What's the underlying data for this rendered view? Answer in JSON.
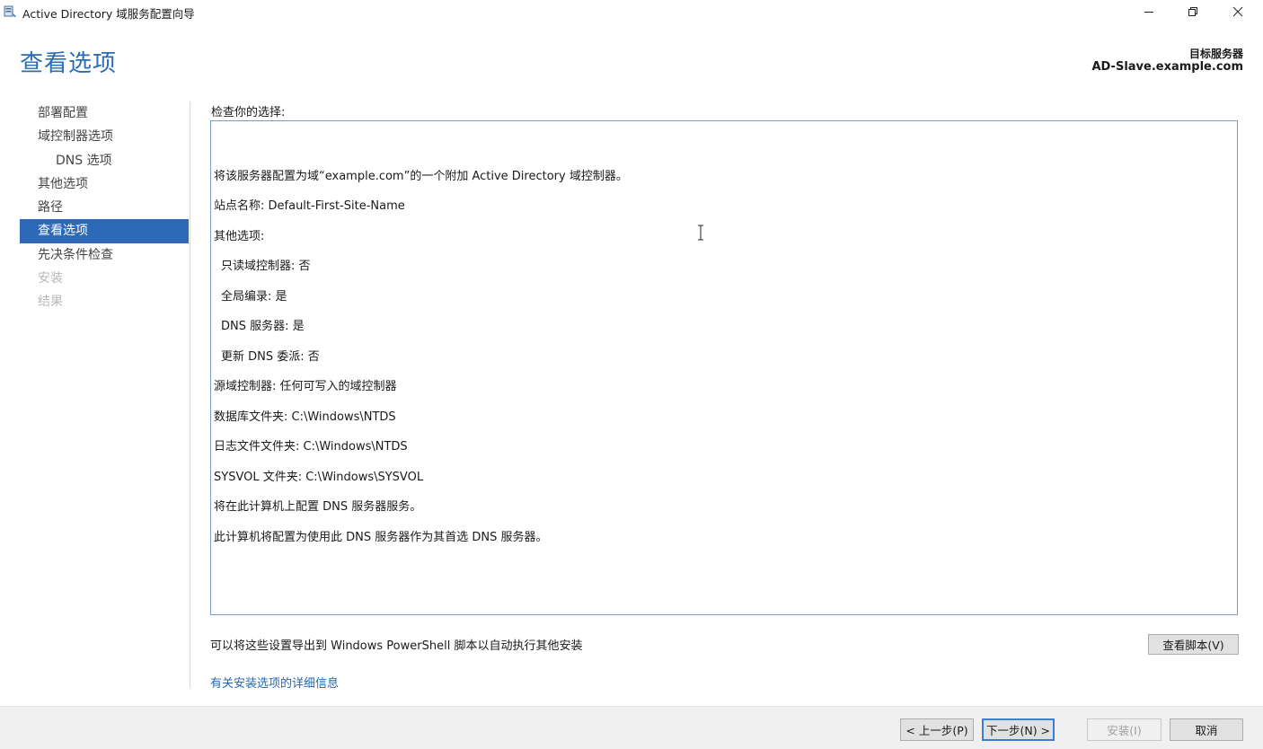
{
  "window": {
    "title": "Active Directory 域服务配置向导",
    "icon": "server-wizard-icon"
  },
  "header": {
    "page_title": "查看选项",
    "target_server_label": "目标服务器",
    "target_server_value": "AD-Slave.example.com"
  },
  "sidebar": {
    "items": [
      {
        "label": "部署配置",
        "state": "normal"
      },
      {
        "label": "域控制器选项",
        "state": "normal"
      },
      {
        "label": "DNS 选项",
        "state": "sub"
      },
      {
        "label": "其他选项",
        "state": "normal"
      },
      {
        "label": "路径",
        "state": "normal"
      },
      {
        "label": "查看选项",
        "state": "active"
      },
      {
        "label": "先决条件检查",
        "state": "normal"
      },
      {
        "label": "安装",
        "state": "disabled"
      },
      {
        "label": "结果",
        "state": "disabled"
      }
    ]
  },
  "main": {
    "review_label": "检查你的选择:",
    "summary_lines": [
      "将该服务器配置为域“example.com”的一个附加 Active Directory 域控制器。",
      "站点名称: Default-First-Site-Name",
      "其他选项:",
      "只读域控制器: 否",
      "全局编录: 是",
      "DNS 服务器: 是",
      "更新 DNS 委派: 否",
      "源域控制器: 任何可写入的域控制器",
      "数据库文件夹: C:\\Windows\\NTDS",
      "日志文件文件夹: C:\\Windows\\NTDS",
      "SYSVOL 文件夹: C:\\Windows\\SYSVOL",
      "将在此计算机上配置 DNS 服务器服务。",
      "此计算机将配置为使用此 DNS 服务器作为其首选 DNS 服务器。"
    ],
    "export_text": "可以将这些设置导出到 Windows PowerShell 脚本以自动执行其他安装",
    "view_script_button": "查看脚本(V)",
    "more_info_link": "有关安装选项的详细信息"
  },
  "footer": {
    "prev_button": "< 上一步(P)",
    "next_button": "下一步(N) >",
    "install_button": "安装(I)",
    "cancel_button": "取消"
  },
  "colors": {
    "accent": "#2e69b8",
    "title_blue": "#2b6cb3",
    "link_blue": "#2367b5"
  }
}
